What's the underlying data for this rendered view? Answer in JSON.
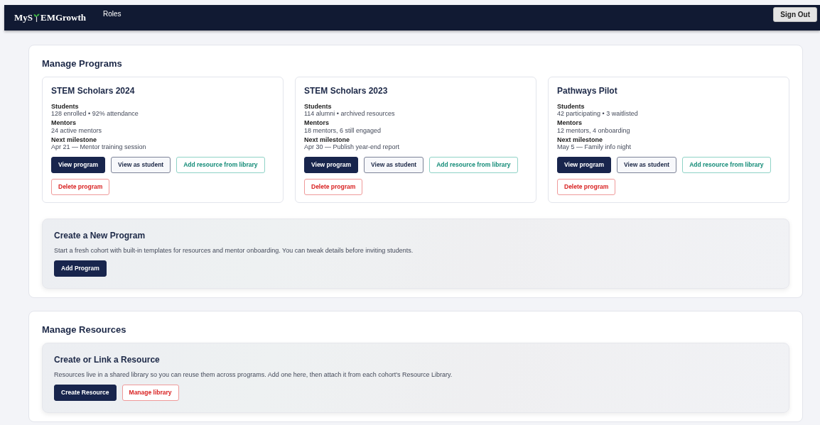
{
  "navbar": {
    "logo_before": "MyS",
    "logo_after": "EMGrowth",
    "links": [
      {
        "label": "Roles"
      }
    ],
    "sign_out": "Sign Out"
  },
  "programs_section": {
    "title": "Manage Programs",
    "programs": [
      {
        "title": "STEM Scholars 2024",
        "facts": [
          {
            "label": "Students",
            "value": "128 enrolled • 92% attendance"
          },
          {
            "label": "Mentors",
            "value": "24 active mentors"
          },
          {
            "label": "Next milestone",
            "value": "Apr 21 — Mentor training session"
          }
        ],
        "buttons": [
          {
            "label": "View program",
            "kind": "primary"
          },
          {
            "label": "View as student",
            "kind": "outline"
          },
          {
            "label": "Add resource from library",
            "kind": "teal"
          },
          {
            "label": "Delete program",
            "kind": "danger"
          }
        ]
      },
      {
        "title": "STEM Scholars 2023",
        "facts": [
          {
            "label": "Students",
            "value": "114 alumni • archived resources"
          },
          {
            "label": "Mentors",
            "value": "18 mentors, 6 still engaged"
          },
          {
            "label": "Next milestone",
            "value": "Apr 30 — Publish year-end report"
          }
        ],
        "buttons": [
          {
            "label": "View program",
            "kind": "primary"
          },
          {
            "label": "View as student",
            "kind": "outline"
          },
          {
            "label": "Add resource from library",
            "kind": "teal"
          },
          {
            "label": "Delete program",
            "kind": "danger"
          }
        ]
      },
      {
        "title": "Pathways Pilot",
        "facts": [
          {
            "label": "Students",
            "value": "42 participating • 3 waitlisted"
          },
          {
            "label": "Mentors",
            "value": "12 mentors, 4 onboarding"
          },
          {
            "label": "Next milestone",
            "value": "May 5 — Family info night"
          }
        ],
        "buttons": [
          {
            "label": "View program",
            "kind": "primary"
          },
          {
            "label": "View as student",
            "kind": "outline"
          },
          {
            "label": "Add resource from library",
            "kind": "teal"
          },
          {
            "label": "Delete program",
            "kind": "danger"
          }
        ]
      }
    ],
    "panel": {
      "title": "Create a New Program",
      "text": "Start a fresh cohort with built-in templates for resources and mentor onboarding. You can tweak details before inviting students.",
      "buttons": [
        {
          "label": "Add Program",
          "kind": "primary"
        }
      ]
    }
  },
  "resources_section": {
    "title": "Manage Resources",
    "panel": {
      "title": "Create or Link a Resource",
      "text": "Resources live in a shared library so you can reuse them across programs. Add one here, then attach it from each cohort's Resource Library.",
      "buttons": [
        {
          "label": "Create Resource",
          "kind": "primary"
        },
        {
          "label": "Manage library",
          "kind": "danger"
        }
      ]
    }
  }
}
